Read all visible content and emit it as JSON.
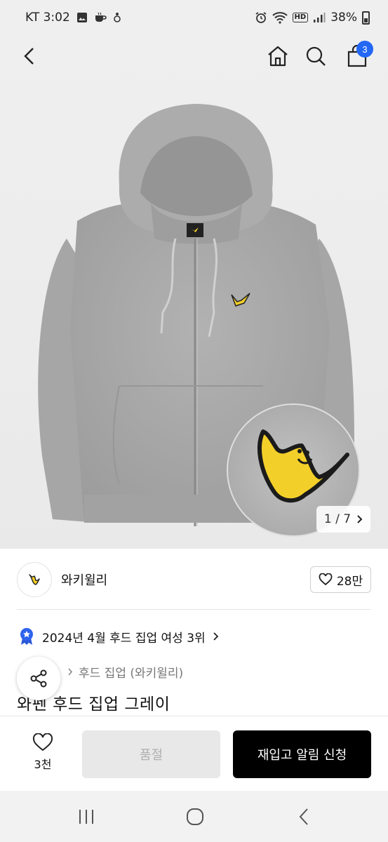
{
  "status_bar": {
    "carrier_time": "KT 3:02",
    "battery": "38%",
    "network_badge": "HD",
    "icons": [
      "gallery-icon",
      "coffee-icon",
      "accessibility-icon",
      "alarm-icon",
      "wifi-icon",
      "signal-icon",
      "battery-icon"
    ]
  },
  "nav": {
    "icons": [
      "back-icon",
      "home-icon",
      "search-icon",
      "cart-icon"
    ],
    "cart_count": "3"
  },
  "gallery": {
    "pager_current": "1",
    "pager_separator": "/",
    "pager_total": "7",
    "pager_icon": "chevron-right-icon"
  },
  "brand": {
    "name": "와키윌리",
    "like_count": "28만",
    "like_icon": "heart-outline-icon"
  },
  "ranking": {
    "text": "2024년 4월 후드 집업 여성 3위",
    "icon": "medal-icon"
  },
  "breadcrumb": {
    "left": "…",
    "category": "후드 집업 (와키윌리)"
  },
  "product": {
    "title": "와펜 후드 집업 그레이"
  },
  "purchase_bar": {
    "wish_count": "3천",
    "soldout_label": "품절",
    "restock_label": "재입고 알림 신청"
  },
  "system_nav": {
    "icons": [
      "recents-icon",
      "home-circle-icon",
      "back-nav-icon"
    ]
  },
  "colors": {
    "accent_blue": "#2367f5",
    "black": "#000000",
    "disabled_bg": "#e8e8e8",
    "hoodie_gray": "#a9a9a9",
    "logo_yellow": "#f3cf2a"
  }
}
